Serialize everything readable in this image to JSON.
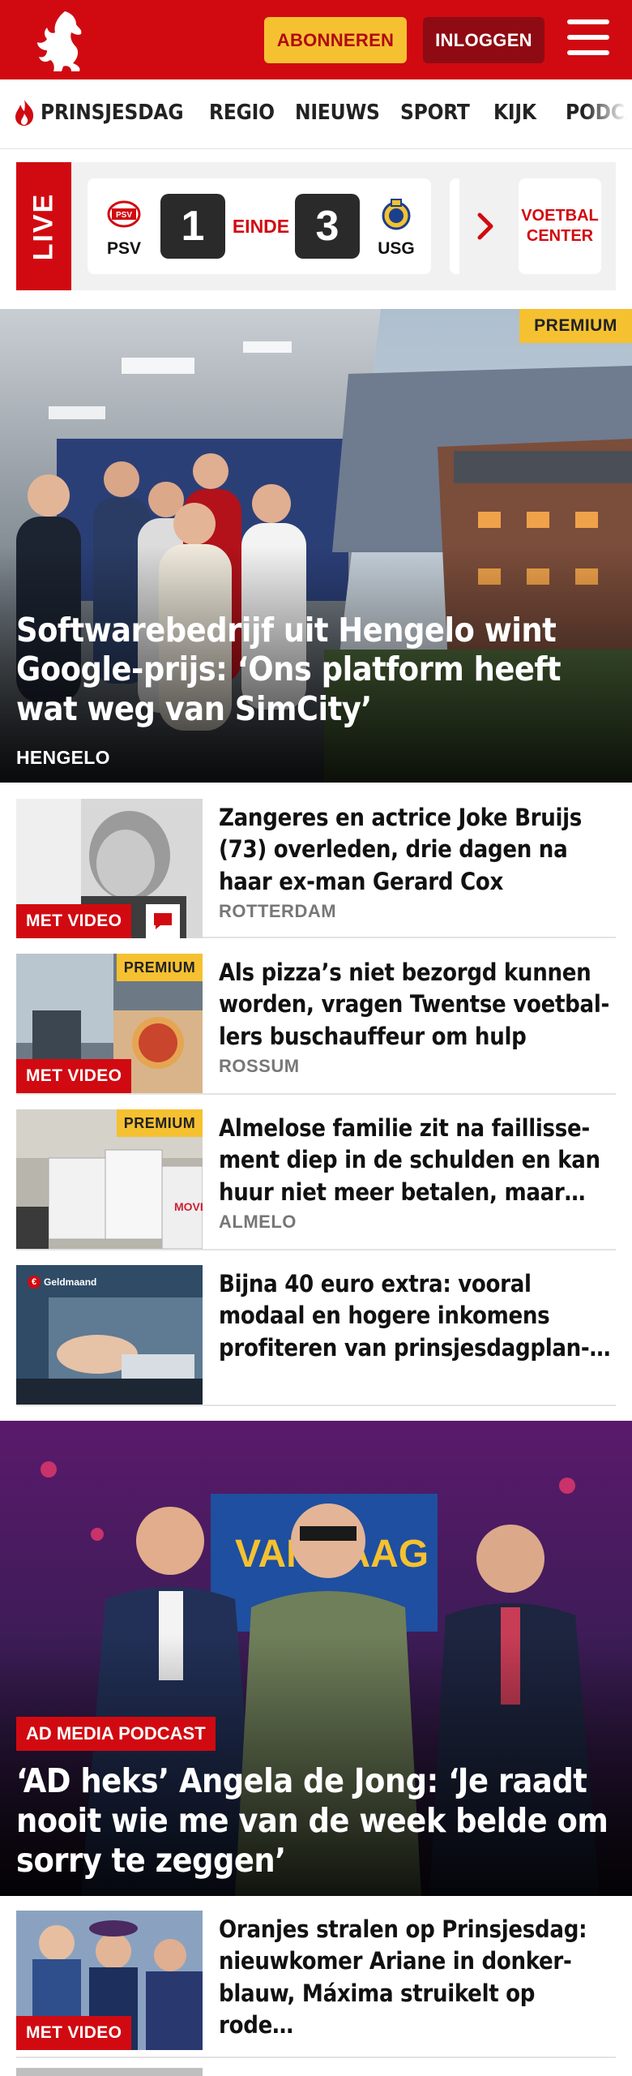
{
  "header": {
    "subscribe_label": "ABONNEREN",
    "login_label": "INLOGGEN",
    "logo_icon": "horse-logo-icon",
    "menu_icon": "hamburger-menu-icon",
    "brand_color": "#d10a11"
  },
  "nav": {
    "items": [
      {
        "label": "PRINSJESDAG",
        "icon": "flame-icon"
      },
      {
        "label": "REGIO"
      },
      {
        "label": "NIEUWS"
      },
      {
        "label": "SPORT"
      },
      {
        "label": "KIJK"
      },
      {
        "label": "PODCA"
      }
    ]
  },
  "live": {
    "tag": "LIVE",
    "home_team": "PSV",
    "home_score": "1",
    "status": "EINDE",
    "away_team": "USG",
    "away_score": "3",
    "link_label": "VOETBAL CENTER"
  },
  "hero": {
    "badge": "PREMIUM",
    "title": "Softwarebedrijf uit Hengelo wint Google-prijs: ‘Ons platform heeft wat weg van SimCity’",
    "location": "HENGELO"
  },
  "articles": [
    {
      "title": "Zangeres en actrice Joke Bruijs (73) overleden, drie dagen na haar ex-man Gerard Cox",
      "location": "ROTTERDAM",
      "video": "MET VIDEO"
    },
    {
      "title": "Als pizza’s niet bezorgd kunnen worden, vragen Twentse voetbal-lers buschauffeur om hulp",
      "location": "ROSSUM",
      "video": "MET VIDEO",
      "badge": "PREMIUM"
    },
    {
      "title": "Almelose familie zit na faillisse-ment diep in de schulden en kan huur niet meer betalen, maar…",
      "location": "ALMELO",
      "badge": "PREMIUM"
    },
    {
      "title": "Bijna 40 euro extra: vooral modaal en hogere inkomens profiteren van prinsjesdagplan-…",
      "thumb_label": "Geldmaand"
    }
  ],
  "podcast": {
    "tag": "AD MEDIA PODCAST",
    "title": "‘AD heks’ Angela de Jong: ‘Je raadt nooit wie me van de week belde om sorry te zeggen’"
  },
  "articles2": [
    {
      "title": "Oranjes stralen op Prinsjesdag: nieuwkomer Ariane in donker-blauw, Máxima struikelt op rode…",
      "video": "MET VIDEO"
    }
  ]
}
